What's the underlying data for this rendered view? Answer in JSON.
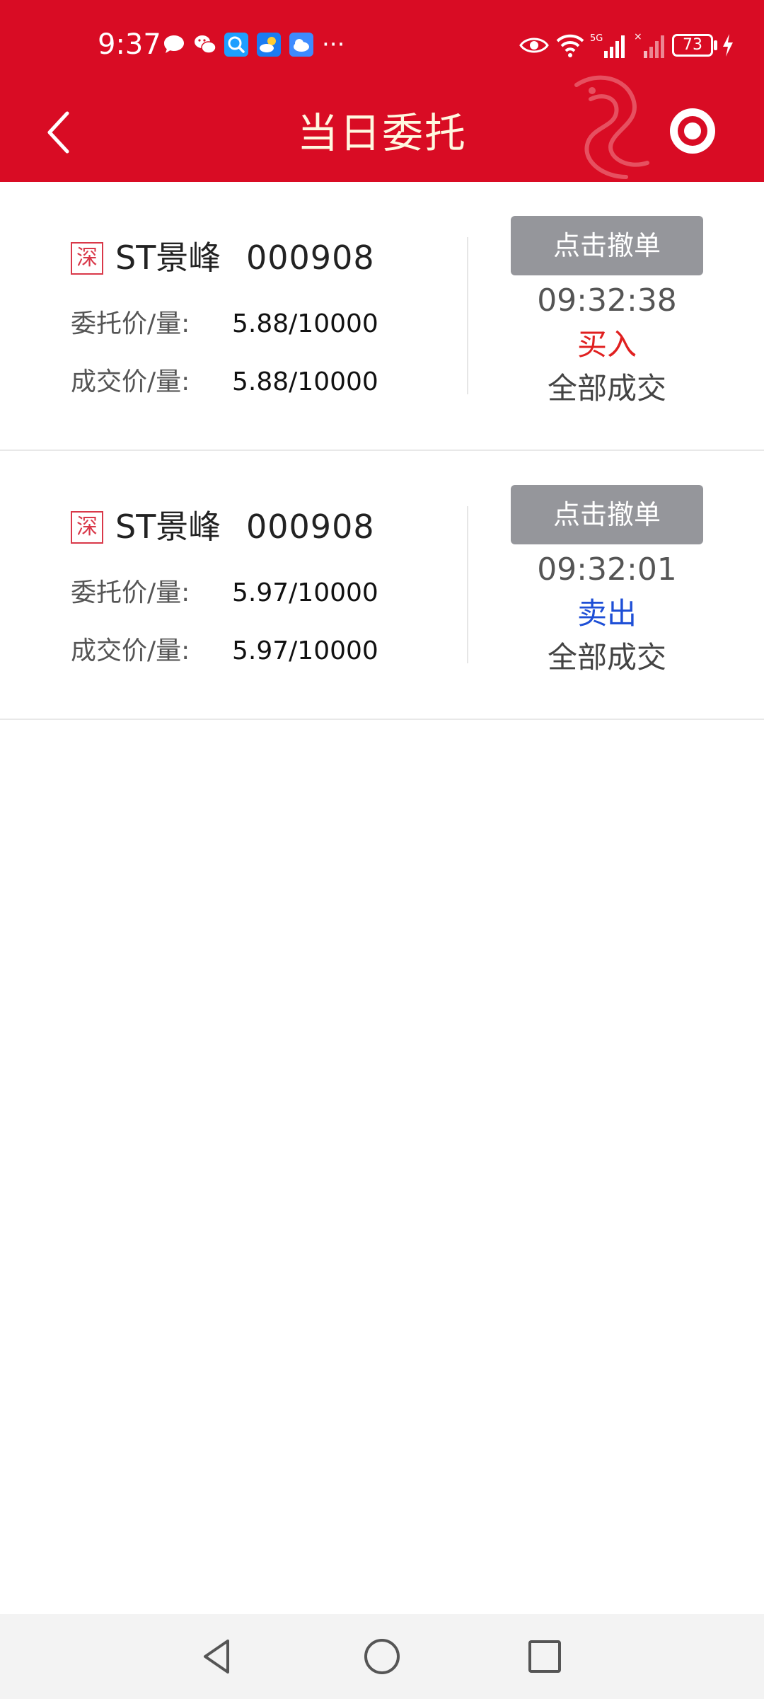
{
  "status_bar": {
    "time": "9:37",
    "more": "···",
    "battery": "73",
    "notification_icons": [
      "message-bubble-icon",
      "wechat-icon",
      "search-app-icon",
      "weather-icon",
      "cloud-icon"
    ],
    "system_icons": [
      "eye-icon",
      "wifi-icon",
      "5g-signal-icon",
      "signal-icon",
      "battery-icon",
      "charging-icon"
    ]
  },
  "header": {
    "title": "当日委托",
    "back_icon": "chevron-left-icon",
    "right_icon": "target-icon",
    "bg_color": "#d90c24"
  },
  "orders": [
    {
      "market": "深",
      "name": "ST景峰",
      "code": "000908",
      "entrust_label": "委托价/量:",
      "entrust_value": "5.88/10000",
      "deal_label": "成交价/量:",
      "deal_value": "5.88/10000",
      "cancel_label": "点击撤单",
      "time": "09:32:38",
      "side": "买入",
      "side_color": "#e02020",
      "status": "全部成交"
    },
    {
      "market": "深",
      "name": "ST景峰",
      "code": "000908",
      "entrust_label": "委托价/量:",
      "entrust_value": "5.97/10000",
      "deal_label": "成交价/量:",
      "deal_value": "5.97/10000",
      "cancel_label": "点击撤单",
      "time": "09:32:01",
      "side": "卖出",
      "side_color": "#1e4fd6",
      "status": "全部成交"
    }
  ],
  "nav_bar": {
    "icons": [
      "back-triangle-icon",
      "home-circle-icon",
      "recents-square-icon"
    ]
  }
}
